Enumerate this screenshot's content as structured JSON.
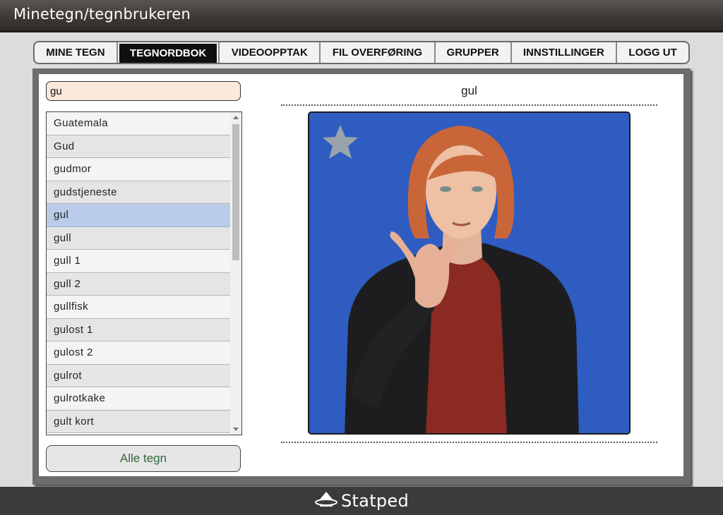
{
  "window": {
    "title": "Minetegn/tegnbrukeren"
  },
  "nav": {
    "tabs": [
      {
        "label": "MINE TEGN",
        "active": false
      },
      {
        "label": "TEGNORDBOK",
        "active": true
      },
      {
        "label": "VIDEOOPPTAK",
        "active": false
      },
      {
        "label": "FIL OVERFØRING",
        "active": false
      },
      {
        "label": "GRUPPER",
        "active": false
      },
      {
        "label": "INNSTILLINGER",
        "active": false
      },
      {
        "label": "LOGG UT",
        "active": false
      }
    ]
  },
  "search": {
    "value": "gu"
  },
  "word_list": {
    "items": [
      "Guatemala",
      "Gud",
      "gudmor",
      "gudstjeneste",
      "gul",
      "gull",
      "gull 1",
      "gull 2",
      "gullfisk",
      "gulost 1",
      "gulost 2",
      "gulrot",
      "gulrotkake",
      "gult kort"
    ],
    "selected": "gul"
  },
  "all_signs_button": {
    "label": "Alle tegn"
  },
  "viewer": {
    "word": "gul",
    "favorite_icon": "star-icon",
    "video_background": "#2f5ec4"
  },
  "footer": {
    "brand": "Statped",
    "logo_icon": "statped-logo-icon"
  },
  "colors": {
    "accent_active_tab": "#0f0f0f",
    "search_bg": "#fbe9d9",
    "selected_row": "#b9cdea",
    "button_text": "#2f6a3c"
  }
}
